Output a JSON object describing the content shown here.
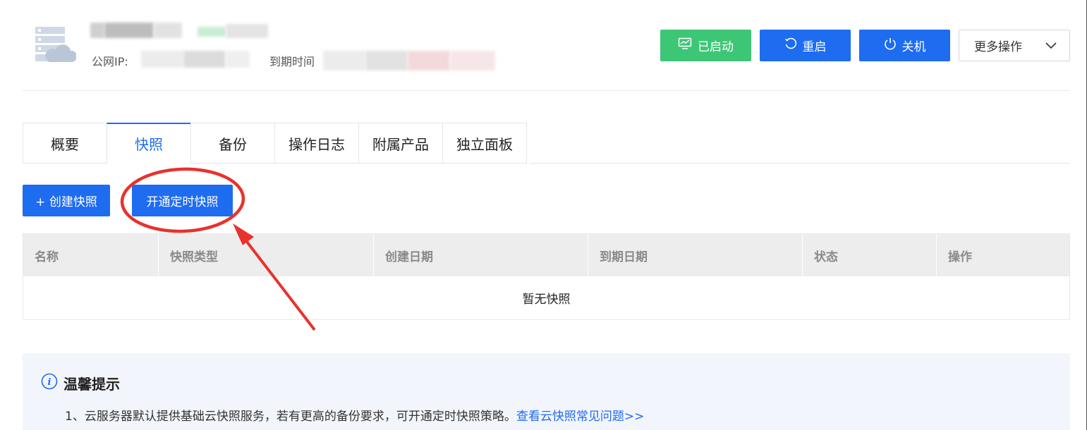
{
  "header": {
    "public_ip_label": "公网IP:",
    "expire_label": "到期时间"
  },
  "top_actions": {
    "started_label": "已启动",
    "restart_label": "重启",
    "shutdown_label": "关机",
    "more_label": "更多操作"
  },
  "tabs": [
    {
      "label": "概要",
      "active": false
    },
    {
      "label": "快照",
      "active": true
    },
    {
      "label": "备份",
      "active": false
    },
    {
      "label": "操作日志",
      "active": false
    },
    {
      "label": "附属产品",
      "active": false
    },
    {
      "label": "独立面板",
      "active": false
    }
  ],
  "snapshot": {
    "create_label": "+ 创建快照",
    "timed_label": "开通定时快照",
    "columns": [
      "名称",
      "快照类型",
      "创建日期",
      "到期日期",
      "状态",
      "操作"
    ],
    "empty_text": "暂无快照"
  },
  "tips": {
    "title": "温馨提示",
    "text": "1、云服务器默认提供基础云快照服务，若有更高的备份要求，可开通定时快照策略。",
    "link": "查看云快照常见问题>>"
  },
  "colors": {
    "primary": "#1e6cf0",
    "success": "#3ec677",
    "annotation": "#e8322d"
  },
  "icons": {
    "server": "server-cloud-icon",
    "monitor": "monitor-icon",
    "restart": "restart-icon",
    "power": "power-icon",
    "chevron": "chevron-down-icon",
    "info": "info-icon"
  }
}
